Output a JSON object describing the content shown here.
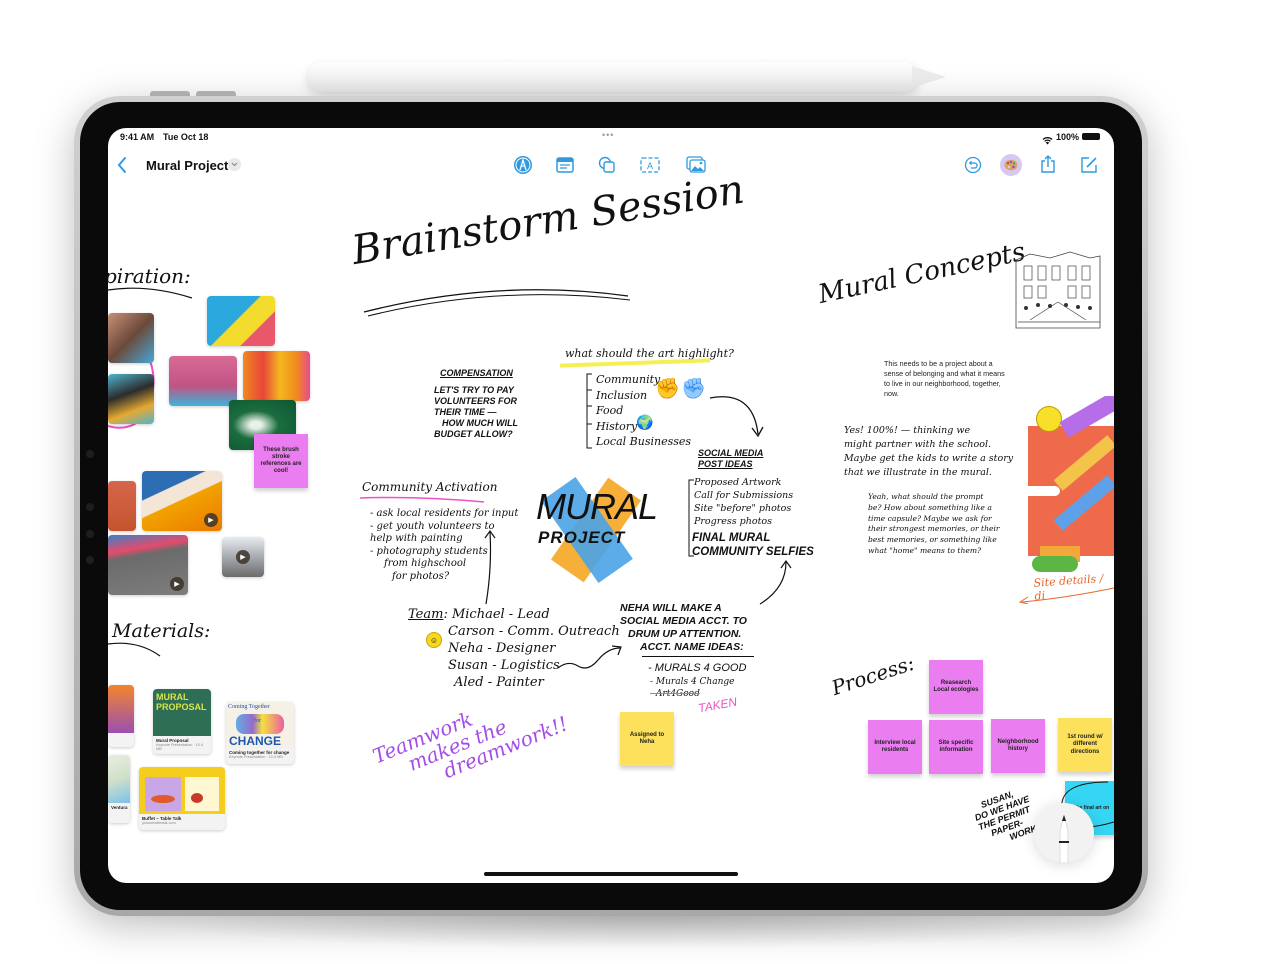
{
  "status_bar": {
    "time": "9:41 AM",
    "date": "Tue Oct 18",
    "battery": "100%",
    "multitask_dots": "•••"
  },
  "nav": {
    "back_icon": "chevron-left-icon",
    "title": "Mural Project",
    "title_menu_icon": "chevron-down-icon",
    "tools": [
      {
        "name": "pen-tool",
        "icon": "pencil-circle-icon"
      },
      {
        "name": "sticky-note-tool",
        "icon": "note-icon"
      },
      {
        "name": "shapes-tool",
        "icon": "shapes-icon"
      },
      {
        "name": "text-box-tool",
        "icon": "textbox-icon"
      },
      {
        "name": "media-tool",
        "icon": "photo-icon"
      }
    ],
    "right_actions": [
      {
        "name": "undo",
        "icon": "undo-icon"
      },
      {
        "name": "collaborators",
        "icon": "palette-avatar-icon"
      },
      {
        "name": "share",
        "icon": "share-icon"
      },
      {
        "name": "new-board",
        "icon": "compose-icon"
      }
    ]
  },
  "board": {
    "headings": {
      "inspiration": "piration:",
      "brainstorm": "Brainstorm Session",
      "mural_concepts": "Mural Concepts",
      "materials": "Materials:",
      "process": "Process:"
    },
    "art_question": "what should the art highlight?",
    "highlights": [
      "Community",
      "Inclusion",
      "Food",
      "History",
      "Local Businesses"
    ],
    "compensation": {
      "title": "Compensation",
      "lines": [
        "Let's try to pay",
        "volunteers for",
        "their time —",
        "how much will",
        "budget allow?"
      ]
    },
    "social_media": {
      "title": [
        "Social Media",
        "Post Ideas"
      ],
      "items": [
        "Proposed Artwork",
        "Call for Submissions",
        "Site \"before\" photos",
        "Progress photos"
      ],
      "bold_items": [
        "Final Mural",
        "Community Selfies"
      ]
    },
    "community_activation": {
      "title": "Community Activation",
      "items": [
        "- ask local residents for input",
        "- get youth volunteers to",
        "help with painting",
        "- photography students",
        "from highschool",
        "for photos?"
      ]
    },
    "logo": {
      "line1": "MURAL",
      "line2": "PROJECT"
    },
    "team": {
      "label": "Team",
      "members": [
        "Michael - Lead",
        "Carson - Comm. Outreach",
        "Neha - Designer",
        "Susan - Logistics",
        "Aled - Painter"
      ]
    },
    "neha_note": {
      "lines": [
        "Neha will make a",
        "social media acct. to",
        "drum up attention.",
        "Acct. name ideas:"
      ],
      "ideas": [
        "- Murals 4 Good",
        "- Murals 4 Change",
        "- Art4Good"
      ],
      "taken": "Taken"
    },
    "teamwork": [
      "Teamwork",
      "makes the",
      "dreamwork!!"
    ],
    "concept_text": "This needs to be a project about a sense of belonging and what it means to live in our neighborhood, together, now.",
    "reply1": [
      "Yes! 100%! — thinking we",
      "might partner with the school.",
      "Maybe get the kids to write a story",
      "that we illustrate in the mural."
    ],
    "reply2": [
      "Yeah, what should the prompt",
      "be? How about something like a",
      "time capsule? Maybe we ask for",
      "their strongest memories, or their",
      "best memories, or something like",
      "what \"home\" means to them?"
    ],
    "site_details": "Site details / di",
    "susan_note": [
      "Susan,",
      "do we have",
      "the permit",
      "paper-",
      "work"
    ],
    "stickies": {
      "brush": "These brush stroke references are cool!",
      "assigned": "Assigned to Neha",
      "research": "Reasearch Local ecologies",
      "interview": "Interview local residents",
      "site": "Site specific information",
      "history": "Neighborhood history",
      "first_round": "1st round w/ different directions",
      "final": "the final art on"
    },
    "materials": [
      {
        "title": "Mural Proposal",
        "subtitle": "Keynote Presentation · 10.4 MB",
        "cover": "MURAL PROPOSAL"
      },
      {
        "title": "Coming together for change",
        "subtitle": "Keynote Presentation · 10.4 MB",
        "cover_top": "Coming Together",
        "cover_mid": "for",
        "cover_bottom": "CHANGE"
      },
      {
        "title": "Buffet – Table Talk",
        "subtitle": "jolnourtabletalk.com"
      },
      {
        "title": "Ventura",
        "subtitle": ""
      }
    ]
  },
  "colors": {
    "accent": "#2f9ae0",
    "sticky_pink": "#ea7df0",
    "sticky_yellow": "#fde05b",
    "sticky_cyan": "#35d6f3",
    "highlight_pink": "#e94fc0",
    "teamwork_purple": "#a44de6",
    "site_orange": "#e8662b"
  }
}
